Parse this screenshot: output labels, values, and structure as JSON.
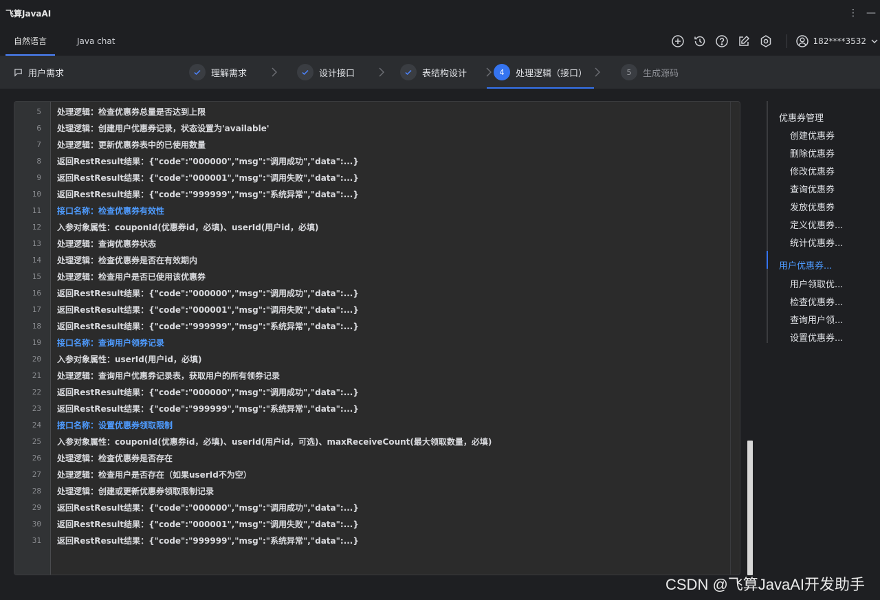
{
  "app": {
    "title": "飞算JavaAI"
  },
  "tabs": [
    {
      "label": "自然语言",
      "active": true
    },
    {
      "label": "Java chat",
      "active": false
    }
  ],
  "toolbar": {
    "icons": [
      "add-icon",
      "history-icon",
      "help-icon",
      "edit-icon",
      "settings-icon"
    ],
    "user_label": "182****3532"
  },
  "steps_bar": {
    "requirement_label": "用户需求",
    "steps": [
      {
        "label": "理解需求",
        "state": "done"
      },
      {
        "label": "设计接口",
        "state": "done"
      },
      {
        "label": "表结构设计",
        "state": "done"
      },
      {
        "number": "4",
        "label": "处理逻辑（接口）",
        "state": "current"
      },
      {
        "number": "5",
        "label": "生成源码",
        "state": "pending"
      }
    ]
  },
  "editor": {
    "lines": [
      {
        "n": "5",
        "text": "处理逻辑：检查优惠券总量是否达到上限",
        "kind": "normal"
      },
      {
        "n": "6",
        "text": "处理逻辑：创建用户优惠券记录，状态设置为'available'",
        "kind": "normal"
      },
      {
        "n": "7",
        "text": "处理逻辑：更新优惠券表中的已使用数量",
        "kind": "normal"
      },
      {
        "n": "8",
        "text": "返回RestResult结果：{\"code\":\"000000\",\"msg\":\"调用成功\",\"data\":...}",
        "kind": "normal"
      },
      {
        "n": "9",
        "text": "返回RestResult结果：{\"code\":\"000001\",\"msg\":\"调用失败\",\"data\":...}",
        "kind": "normal"
      },
      {
        "n": "10",
        "text": "返回RestResult结果：{\"code\":\"999999\",\"msg\":\"系统异常\",\"data\":...}",
        "kind": "normal"
      },
      {
        "n": "11",
        "text": "接口名称：检查优惠券有效性",
        "kind": "heading"
      },
      {
        "n": "12",
        "text": "入参对象属性：couponId(优惠券id，必填)、userId(用户id，必填)",
        "kind": "normal"
      },
      {
        "n": "13",
        "text": "处理逻辑：查询优惠券状态",
        "kind": "normal"
      },
      {
        "n": "14",
        "text": "处理逻辑：检查优惠券是否在有效期内",
        "kind": "normal"
      },
      {
        "n": "15",
        "text": "处理逻辑：检查用户是否已使用该优惠券",
        "kind": "normal"
      },
      {
        "n": "16",
        "text": "返回RestResult结果：{\"code\":\"000000\",\"msg\":\"调用成功\",\"data\":...}",
        "kind": "normal"
      },
      {
        "n": "17",
        "text": "返回RestResult结果：{\"code\":\"000001\",\"msg\":\"调用失败\",\"data\":...}",
        "kind": "normal"
      },
      {
        "n": "18",
        "text": "返回RestResult结果：{\"code\":\"999999\",\"msg\":\"系统异常\",\"data\":...}",
        "kind": "normal"
      },
      {
        "n": "19",
        "text": "接口名称：查询用户领券记录",
        "kind": "heading"
      },
      {
        "n": "20",
        "text": "入参对象属性：userId(用户id，必填)",
        "kind": "normal"
      },
      {
        "n": "21",
        "text": "处理逻辑：查询用户优惠券记录表，获取用户的所有领券记录",
        "kind": "normal"
      },
      {
        "n": "22",
        "text": "返回RestResult结果：{\"code\":\"000000\",\"msg\":\"调用成功\",\"data\":...}",
        "kind": "normal"
      },
      {
        "n": "23",
        "text": "返回RestResult结果：{\"code\":\"999999\",\"msg\":\"系统异常\",\"data\":...}",
        "kind": "normal"
      },
      {
        "n": "24",
        "text": "接口名称：设置优惠券领取限制",
        "kind": "heading"
      },
      {
        "n": "25",
        "text": "入参对象属性：couponId(优惠券id，必填)、userId(用户id，可选)、maxReceiveCount(最大领取数量，必填)",
        "kind": "normal"
      },
      {
        "n": "26",
        "text": "处理逻辑：检查优惠券是否存在",
        "kind": "normal"
      },
      {
        "n": "27",
        "text": "处理逻辑：检查用户是否存在（如果userId不为空）",
        "kind": "normal"
      },
      {
        "n": "28",
        "text": "处理逻辑：创建或更新优惠券领取限制记录",
        "kind": "normal"
      },
      {
        "n": "29",
        "text": "返回RestResult结果：{\"code\":\"000000\",\"msg\":\"调用成功\",\"data\":...}",
        "kind": "normal"
      },
      {
        "n": "30",
        "text": "返回RestResult结果：{\"code\":\"000001\",\"msg\":\"调用失败\",\"data\":...}",
        "kind": "normal"
      },
      {
        "n": "31",
        "text": "返回RestResult结果：{\"code\":\"999999\",\"msg\":\"系统异常\",\"data\":...}",
        "kind": "normal"
      }
    ]
  },
  "outline": {
    "items": [
      {
        "label": "优惠券管理",
        "level": "top",
        "active": false
      },
      {
        "label": "创建优惠券",
        "level": "sub",
        "active": false
      },
      {
        "label": "删除优惠券",
        "level": "sub",
        "active": false
      },
      {
        "label": "修改优惠券",
        "level": "sub",
        "active": false
      },
      {
        "label": "查询优惠券",
        "level": "sub",
        "active": false
      },
      {
        "label": "发放优惠券",
        "level": "sub",
        "active": false
      },
      {
        "label": "定义优惠券...",
        "level": "sub",
        "active": false
      },
      {
        "label": "统计优惠券...",
        "level": "sub",
        "active": false
      },
      {
        "label": "用户优惠券...",
        "level": "top",
        "active": true
      },
      {
        "label": "用户领取优...",
        "level": "sub",
        "active": false
      },
      {
        "label": "检查优惠券...",
        "level": "sub",
        "active": false
      },
      {
        "label": "查询用户领...",
        "level": "sub",
        "active": false
      },
      {
        "label": "设置优惠券...",
        "level": "sub",
        "active": false
      }
    ]
  },
  "watermark": "CSDN @飞算JavaAI开发助手",
  "colors": {
    "accent": "#3574f0",
    "heading_text": "#4e9bff",
    "background": "#1e1f22"
  }
}
